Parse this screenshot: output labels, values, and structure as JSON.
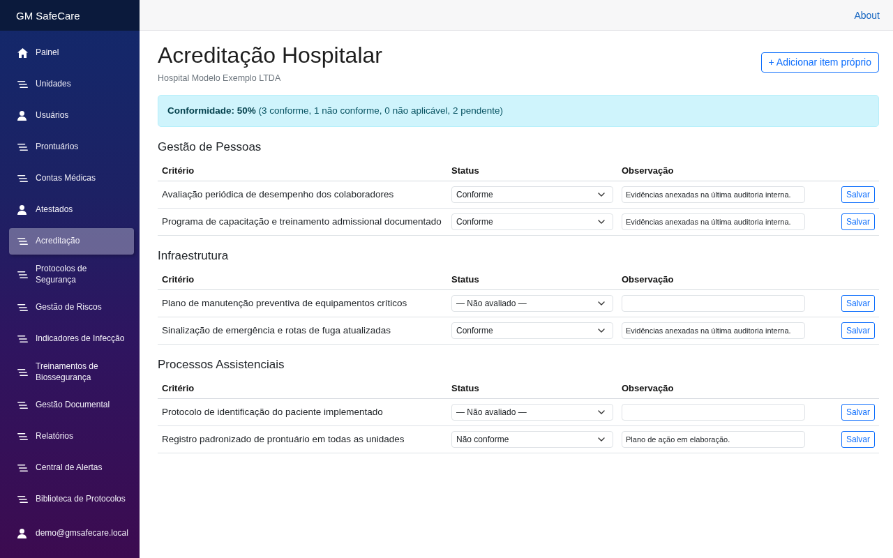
{
  "sidebar": {
    "brand": "GM SafeCare",
    "items": [
      {
        "label": "Painel",
        "kind": "home",
        "selected": false
      },
      {
        "label": "Unidades",
        "kind": "list",
        "selected": false
      },
      {
        "label": "Usuários",
        "kind": "user",
        "selected": false
      },
      {
        "label": "Prontuários",
        "kind": "list",
        "selected": false
      },
      {
        "label": "Contas Médicas",
        "kind": "list",
        "selected": false
      },
      {
        "label": "Atestados",
        "kind": "user",
        "selected": false
      },
      {
        "label": "Acreditação",
        "kind": "list",
        "selected": true
      },
      {
        "label": "Protocolos de\nSegurança",
        "kind": "list",
        "selected": false
      },
      {
        "label": "Gestão de Riscos",
        "kind": "list",
        "selected": false
      },
      {
        "label": "Indicadores de Infecção",
        "kind": "list",
        "selected": false
      },
      {
        "label": "Treinamentos de\nBiossegurança",
        "kind": "list",
        "selected": false
      },
      {
        "label": "Gestão Documental",
        "kind": "list",
        "selected": false
      },
      {
        "label": "Relatórios",
        "kind": "list",
        "selected": false
      },
      {
        "label": "Central de Alertas",
        "kind": "list",
        "selected": false
      },
      {
        "label": "Biblioteca de Protocolos",
        "kind": "list",
        "selected": false
      }
    ],
    "account": {
      "label": "demo@gmsafecare.local",
      "kind": "user"
    }
  },
  "topbar": {
    "links": [
      "About"
    ]
  },
  "header": {
    "title": "Acreditação Hospitalar",
    "subtitle": "Hospital Modelo Exemplo LTDA",
    "add_button": "+ Adicionar item próprio"
  },
  "summary": "**Conformidade: 50%** (3 conforme, 1 não conforme, 0 não aplicável, 2 pendente)",
  "sections": [
    {
      "title": "Gestão de Pessoas",
      "columns": [
        "Critério",
        "Status",
        "Observação"
      ],
      "rows": [
        {
          "criterion": "Avaliação periódica de desempenho dos colaboradores",
          "status": "Conforme",
          "observation": "Evidências anexadas na última auditoria interna.",
          "button": "Salvar"
        },
        {
          "criterion": "Programa de capacitação e treinamento admissional documentado",
          "status": "Conforme",
          "observation": "Evidências anexadas na última auditoria interna.",
          "button": "Salvar"
        }
      ]
    },
    {
      "title": "Infraestrutura",
      "columns": [
        "Critério",
        "Status",
        "Observação"
      ],
      "rows": [
        {
          "criterion": "Plano de manutenção preventiva de equipamentos críticos",
          "status": "— Não avaliado —",
          "button": "Salvar"
        },
        {
          "criterion": "Sinalização de emergência e rotas de fuga atualizadas",
          "status": "Conforme",
          "observation": "Evidências anexadas na última auditoria interna.",
          "button": "Salvar"
        }
      ]
    },
    {
      "title": "Processos Assistenciais",
      "columns": [
        "Critério",
        "Status",
        "Observação"
      ],
      "rows": [
        {
          "criterion": "Protocolo de identificação do paciente implementado",
          "status": "— Não avaliado —",
          "button": "Salvar"
        },
        {
          "criterion": "Registro padronizado de prontuário em todas as unidades",
          "status": "Não conforme",
          "observation": "Plano de ação em elaboração.",
          "button": "Salvar"
        }
      ]
    }
  ]
}
